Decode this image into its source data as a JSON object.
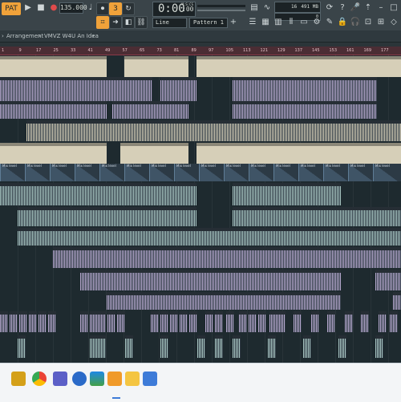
{
  "toolbar": {
    "tempo": "135.000",
    "time": "0:00",
    "time_sub": ":00",
    "time_label": "M:S:CS",
    "pattern": "Pattern 1",
    "snap": "Line",
    "cpu": "16",
    "memory": "491 MB",
    "memory_count": "0"
  },
  "browser": {
    "title": "Arrangement",
    "path": "VMVZ W4U An Idea"
  },
  "ruler": {
    "ticks": [
      "1",
      "9",
      "17",
      "25",
      "33",
      "41",
      "49",
      "57",
      "65",
      "73",
      "81",
      "89",
      "97",
      "105",
      "113",
      "121",
      "129",
      "137",
      "145",
      "153",
      "161",
      "169",
      "177"
    ]
  },
  "automation": {
    "label": "Mix level"
  },
  "colors": {
    "accent": "#f0a23a",
    "wave_lavender": "#b7a9cf",
    "wave_teal": "#a9c7c3",
    "wave_tan": "#d6cfb8",
    "ruler": "#4b2d34"
  },
  "taskbar": {
    "icons": [
      "file-explorer-icon",
      "chrome-icon",
      "teams-icon",
      "edge-icon",
      "drive-icon",
      "fl-studio-icon",
      "paint-icon",
      "store-icon"
    ]
  }
}
